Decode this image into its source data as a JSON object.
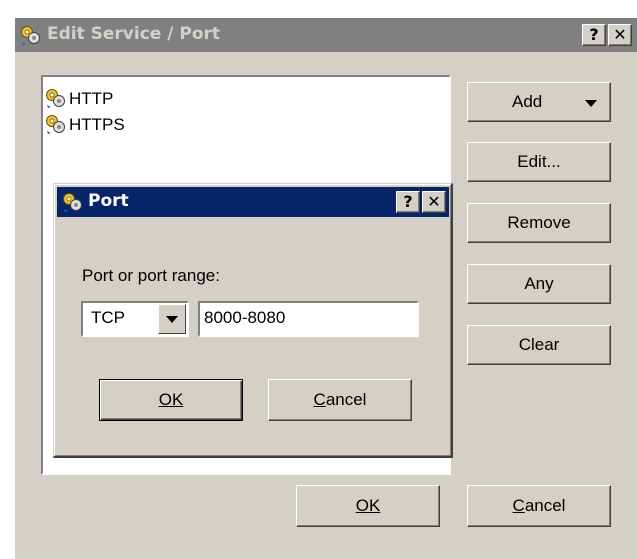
{
  "window": {
    "title": "Edit Service / Port",
    "help_label": "?",
    "close_label": "✕"
  },
  "list": {
    "items": [
      {
        "label": "HTTP"
      },
      {
        "label": "HTTPS"
      }
    ]
  },
  "side_buttons": {
    "add": "Add",
    "edit": "Edit...",
    "remove": "Remove",
    "any": "Any",
    "clear": "Clear"
  },
  "footer": {
    "ok": "OK",
    "cancel": "Cancel"
  },
  "port_dialog": {
    "title": "Port",
    "help_label": "?",
    "close_label": "✕",
    "field_label": "Port or port range:",
    "protocol_selected": "TCP",
    "port_value": "8000-8080",
    "ok": "OK",
    "cancel": "Cancel"
  },
  "colors": {
    "face": "#d4d0c8",
    "inactive_title": "#808080",
    "active_title": "#0a246a",
    "window_bg": "#ffffff"
  },
  "icons": {
    "service_icon": "service-gears-icon",
    "dropdown": "chevron-down-icon"
  }
}
